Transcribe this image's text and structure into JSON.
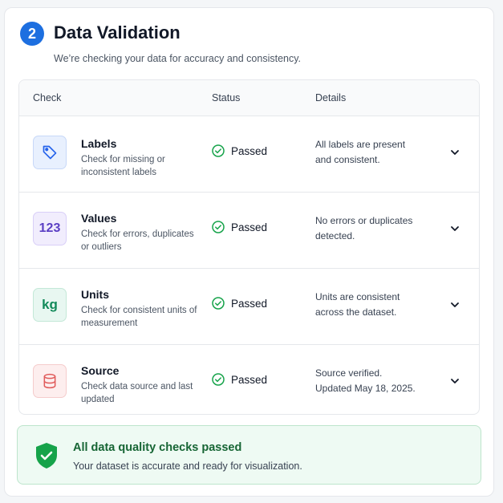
{
  "header": {
    "step_number": "2",
    "title": "Data Validation",
    "subtitle": "We’re checking your data for accuracy and consistency."
  },
  "table": {
    "columns": [
      "Check",
      "Status",
      "Details"
    ],
    "rows": [
      {
        "name": "Labels",
        "description": "Check for missing or inconsistent labels",
        "status": "Passed",
        "details": "All labels are present and consistent.",
        "icon": "tag-icon"
      },
      {
        "name": "Values",
        "description": "Check for errors, duplicates or outliers",
        "status": "Passed",
        "details": "No errors or duplicates detected.",
        "icon": "number-icon",
        "icon_text": "123"
      },
      {
        "name": "Units",
        "description": "Check for consistent units of measurement",
        "status": "Passed",
        "details": "Units are consistent across the dataset.",
        "icon": "kg-icon",
        "icon_text": "kg"
      },
      {
        "name": "Source",
        "description": "Check data source and last updated",
        "status": "Passed",
        "details": "Source verified. Updated May 18, 2025.",
        "icon": "database-icon"
      }
    ]
  },
  "banner": {
    "title": "All data quality checks passed",
    "text": "Your dataset is accurate and ready for visualization.",
    "icon": "shield-check-icon"
  },
  "colors": {
    "accent": "#1d6fe0",
    "success": "#16a34a",
    "labels_tint": "#e8f0fe",
    "values_tint": "#f1edfd",
    "units_tint": "#e8f7f1",
    "source_tint": "#fdeeee"
  }
}
